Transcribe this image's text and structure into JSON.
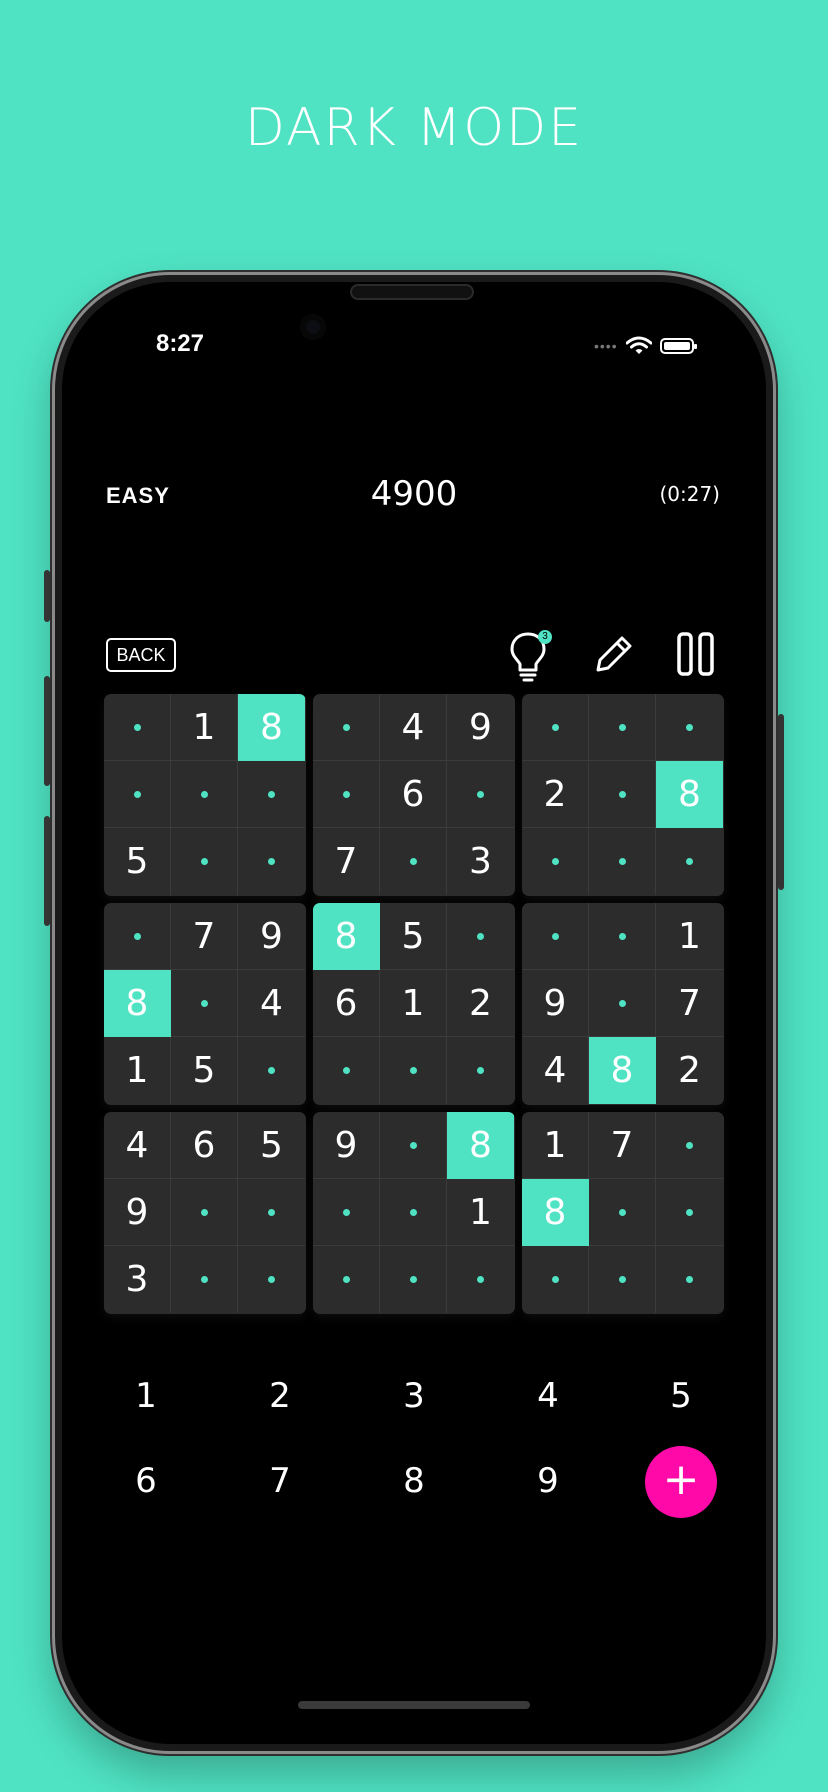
{
  "headline": "DARK MODE",
  "status_bar": {
    "time": "8:27"
  },
  "header": {
    "level": "EASY",
    "score": "4900",
    "timer": "(0:27)"
  },
  "toolbar": {
    "back_label": "BACK",
    "hint_count": "3"
  },
  "colors": {
    "accent": "#4fe3c3",
    "fab": "#ff0aa8",
    "cell_bg": "#2c2c2c",
    "background": "#000000"
  },
  "icons": [
    "lightbulb-icon",
    "pencil-icon",
    "pause-icon",
    "plus-icon",
    "wifi-icon",
    "battery-icon"
  ],
  "board": {
    "rows": [
      [
        "",
        "1",
        "8",
        "",
        "4",
        "9",
        "",
        "",
        ""
      ],
      [
        "",
        "",
        "",
        "",
        "6",
        "",
        "2",
        "",
        "8"
      ],
      [
        "5",
        "",
        "",
        "7",
        "",
        "3",
        "",
        "",
        ""
      ],
      [
        "",
        "7",
        "9",
        "8",
        "5",
        "",
        "",
        "",
        "1"
      ],
      [
        "8",
        "",
        "4",
        "6",
        "1",
        "2",
        "9",
        "",
        "7"
      ],
      [
        "1",
        "5",
        "",
        "",
        "",
        "",
        "4",
        "8",
        "2"
      ],
      [
        "4",
        "6",
        "5",
        "9",
        "",
        "8",
        "1",
        "7",
        ""
      ],
      [
        "9",
        "",
        "",
        "",
        "",
        "1",
        "8",
        "",
        ""
      ],
      [
        "3",
        "",
        "",
        "",
        "",
        "",
        "",
        "",
        ""
      ]
    ],
    "highlighted": [
      [
        0,
        2
      ],
      [
        1,
        8
      ],
      [
        3,
        3
      ],
      [
        4,
        0
      ],
      [
        5,
        7
      ],
      [
        6,
        5
      ],
      [
        7,
        6
      ]
    ]
  },
  "numpad": [
    "1",
    "2",
    "3",
    "4",
    "5",
    "6",
    "7",
    "8",
    "9"
  ],
  "fab_label": "+"
}
